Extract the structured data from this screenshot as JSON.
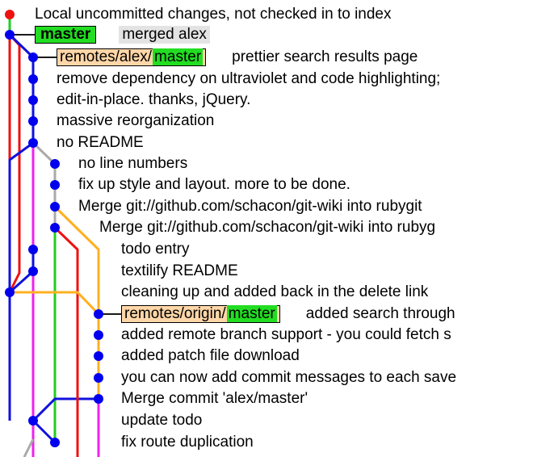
{
  "commits": [
    {
      "message": "Local uncommitted changes, not checked in to index",
      "local_ref": "",
      "remote_ref": null,
      "highlight": false
    },
    {
      "message": "merged alex",
      "local_ref": "master",
      "remote_ref": null,
      "highlight": true
    },
    {
      "message": "prettier search results page",
      "local_ref": "",
      "remote_ref": {
        "remote": "remotes/alex/",
        "branch": "master"
      },
      "highlight": false
    },
    {
      "message": "remove dependency on ultraviolet and code highlighting;",
      "local_ref": "",
      "remote_ref": null,
      "highlight": false
    },
    {
      "message": "edit-in-place.  thanks, jQuery.",
      "local_ref": "",
      "remote_ref": null,
      "highlight": false
    },
    {
      "message": "massive reorganization",
      "local_ref": "",
      "remote_ref": null,
      "highlight": false
    },
    {
      "message": "no README",
      "local_ref": "",
      "remote_ref": null,
      "highlight": false
    },
    {
      "message": "no line numbers",
      "local_ref": "",
      "remote_ref": null,
      "highlight": false
    },
    {
      "message": "fix up style and layout.  more to be done.",
      "local_ref": "",
      "remote_ref": null,
      "highlight": false
    },
    {
      "message": "Merge git://github.com/schacon/git-wiki into rubygit",
      "local_ref": "",
      "remote_ref": null,
      "highlight": false
    },
    {
      "message": "Merge git://github.com/schacon/git-wiki into rubyg",
      "local_ref": "",
      "remote_ref": null,
      "highlight": false
    },
    {
      "message": "todo entry",
      "local_ref": "",
      "remote_ref": null,
      "highlight": false
    },
    {
      "message": "textilify README",
      "local_ref": "",
      "remote_ref": null,
      "highlight": false
    },
    {
      "message": "cleaning up and added back in the delete link",
      "local_ref": "",
      "remote_ref": null,
      "highlight": false
    },
    {
      "message": "added search through",
      "local_ref": "",
      "remote_ref": {
        "remote": "remotes/origin/",
        "branch": "master"
      },
      "highlight": false
    },
    {
      "message": "added remote branch support - you could fetch s",
      "local_ref": "",
      "remote_ref": null,
      "highlight": false
    },
    {
      "message": "added patch file download",
      "local_ref": "",
      "remote_ref": null,
      "highlight": false
    },
    {
      "message": "you can now add commit messages to each save",
      "local_ref": "",
      "remote_ref": null,
      "highlight": false
    },
    {
      "message": "Merge commit 'alex/master'",
      "local_ref": "",
      "remote_ref": null,
      "highlight": false
    },
    {
      "message": "update todo",
      "local_ref": "",
      "remote_ref": null,
      "highlight": false
    },
    {
      "message": "fix route duplication",
      "local_ref": "",
      "remote_ref": null,
      "highlight": false
    }
  ],
  "colors": {
    "uncommitted_node": "#ee1111",
    "node": "#0000ee",
    "branch_line": "#1a1a1a",
    "lane_red": "#ee1111",
    "lane_blue": "#1111dd",
    "lane_green": "#22cc22",
    "lane_magenta": "#ee22ee",
    "lane_gray": "#aaaaaa",
    "lane_orange": "#ffb020",
    "local_ref_bg": "#22dd22",
    "remote_ref_bg": "#ffd6a8"
  }
}
